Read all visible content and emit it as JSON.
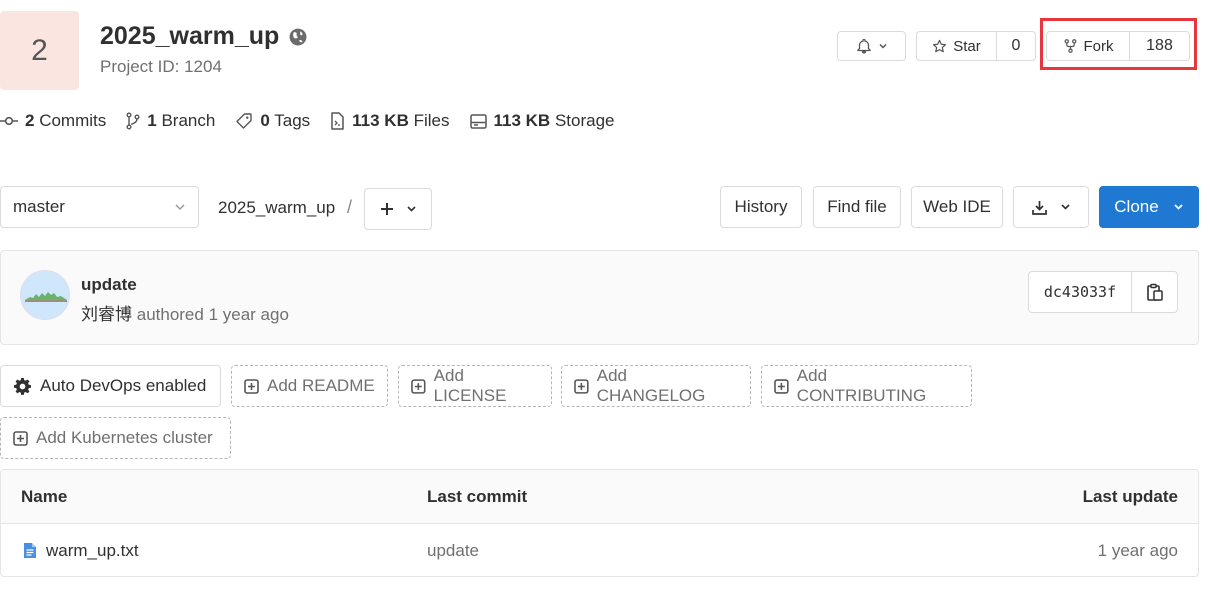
{
  "project": {
    "avatar_letter": "2",
    "name": "2025_warm_up",
    "id_text": "Project ID: 1204"
  },
  "actions": {
    "star_label": "Star",
    "star_count": "0",
    "fork_label": "Fork",
    "fork_count": "188"
  },
  "stats": [
    {
      "value": "2",
      "label": "Commits",
      "icon": "commit-icon"
    },
    {
      "value": "1",
      "label": "Branch",
      "icon": "branch-icon"
    },
    {
      "value": "0",
      "label": "Tags",
      "icon": "tag-icon"
    },
    {
      "value": "113 KB",
      "label": "Files",
      "icon": "file-icon"
    },
    {
      "value": "113 KB",
      "label": "Storage",
      "icon": "storage-icon"
    }
  ],
  "toolbar": {
    "branch": "master",
    "path": "2025_warm_up",
    "path_separator": "/",
    "history_label": "History",
    "find_file_label": "Find file",
    "web_ide_label": "Web IDE",
    "clone_label": "Clone"
  },
  "last_commit": {
    "title": "update",
    "author": "刘睿博",
    "meta": "authored 1 year ago",
    "sha": "dc43033f"
  },
  "quick_actions": [
    {
      "label": "Auto DevOps enabled",
      "style": "solid",
      "icon": "gear-icon"
    },
    {
      "label": "Add README",
      "style": "dashed",
      "icon": "plus-square-icon"
    },
    {
      "label": "Add LICENSE",
      "style": "dashed",
      "icon": "plus-square-icon"
    },
    {
      "label": "Add CHANGELOG",
      "style": "dashed",
      "icon": "plus-square-icon"
    },
    {
      "label": "Add CONTRIBUTING",
      "style": "dashed",
      "icon": "plus-square-icon"
    },
    {
      "label": "Add Kubernetes cluster",
      "style": "dashed",
      "icon": "plus-square-icon"
    }
  ],
  "files_table": {
    "headers": {
      "name": "Name",
      "last_commit": "Last commit",
      "last_update": "Last update"
    },
    "rows": [
      {
        "name": "warm_up.txt",
        "last_commit": "update",
        "last_update": "1 year ago"
      }
    ]
  },
  "colors": {
    "accent": "#1f78d1",
    "highlight": "#e8363f",
    "avatar_bg": "#fbe5e1"
  }
}
